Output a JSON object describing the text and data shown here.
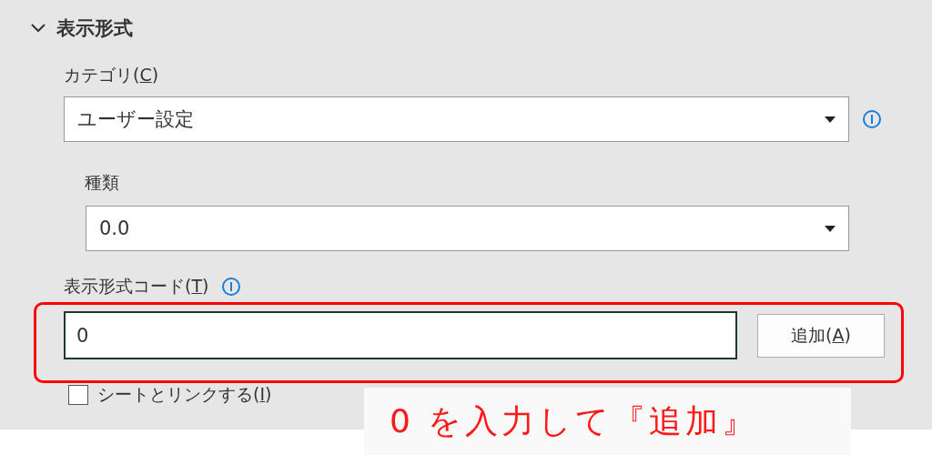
{
  "section": {
    "title": "表示形式",
    "expanded": true
  },
  "category": {
    "label": {
      "before": "カテゴリ(",
      "key": "C",
      "after": ")"
    },
    "value": "ユーザー設定"
  },
  "type": {
    "label": "種類",
    "value": "0.0"
  },
  "format_code": {
    "label": {
      "before": "表示形式コード(",
      "key": "T",
      "after": ")"
    },
    "value": "0",
    "add_button": {
      "before": "追加(",
      "key": "A",
      "after": ")"
    }
  },
  "link_to_sheet": {
    "label": {
      "before": "シートとリンクする(",
      "key": "I",
      "after": ")"
    },
    "checked": false
  },
  "annotation": {
    "text": "0 を入力して『追加』"
  }
}
